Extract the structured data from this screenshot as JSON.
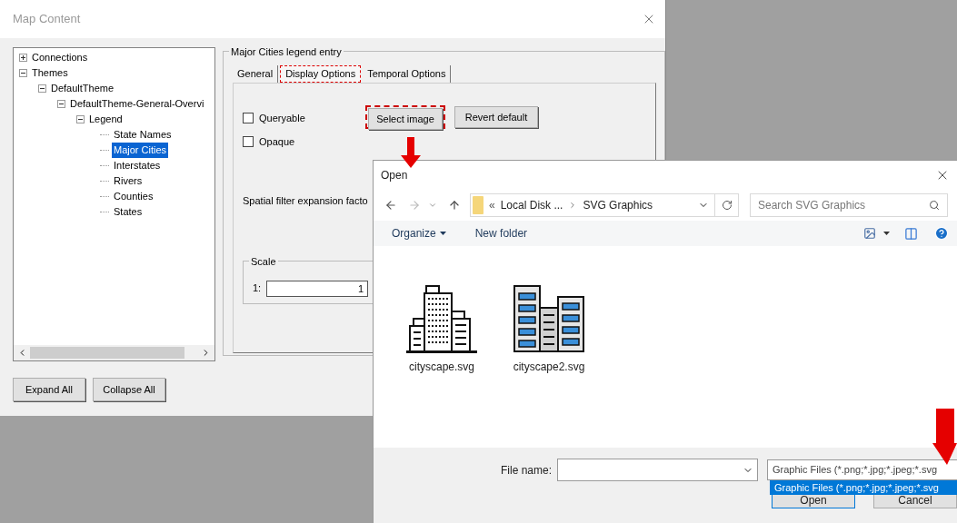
{
  "window": {
    "title": "Map Content"
  },
  "tree": [
    {
      "label": "Connections",
      "expanded": false,
      "selected": false
    },
    {
      "label": "Themes",
      "expanded": true,
      "selected": false,
      "children": [
        {
          "label": "DefaultTheme",
          "expanded": true,
          "selected": false,
          "children": [
            {
              "label": "DefaultTheme-General-Overvi",
              "expanded": true,
              "selected": false,
              "children": [
                {
                  "label": "Legend",
                  "expanded": true,
                  "selected": false,
                  "children": [
                    {
                      "label": "State Names",
                      "selected": false
                    },
                    {
                      "label": "Major Cities",
                      "selected": true
                    },
                    {
                      "label": "Interstates",
                      "selected": false
                    },
                    {
                      "label": "Rivers",
                      "selected": false
                    },
                    {
                      "label": "Counties",
                      "selected": false
                    },
                    {
                      "label": "States",
                      "selected": false
                    }
                  ]
                }
              ]
            }
          ]
        }
      ]
    }
  ],
  "tree_buttons": [
    "Expand All",
    "Collapse All"
  ],
  "entry": {
    "title": "Major Cities legend entry",
    "tabs": [
      {
        "label": "General",
        "selected": false
      },
      {
        "label": "Display Options",
        "selected": true
      },
      {
        "label": "Temporal Options",
        "selected": false
      }
    ],
    "checkboxes": [
      {
        "label": "Queryable",
        "checked": false
      },
      {
        "label": "Opaque",
        "checked": false
      }
    ],
    "buttons": [
      "Select image",
      "Revert default"
    ],
    "spatial_label": "Spatial filter expansion facto",
    "scale": {
      "title": "Scale",
      "prefix": "1:",
      "value": "1"
    }
  },
  "open_dialog": {
    "title": "Open",
    "path": {
      "overflow": "«",
      "segments": [
        "Local Disk ...",
        "SVG Graphics"
      ]
    },
    "search": {
      "placeholder": "Search SVG Graphics"
    },
    "toolbar": [
      "Organize",
      "New folder"
    ],
    "files": [
      {
        "name": "cityscape.svg",
        "kind": "outline"
      },
      {
        "name": "cityscape2.svg",
        "kind": "colored"
      }
    ],
    "file_name": {
      "label": "File name:"
    },
    "file_type": {
      "value": "Graphic Files (*.png;*.jpg;*.jpeg;*.svg",
      "options": [
        {
          "label": "Graphic Files (*.png;*.jpg;*.jpeg;*.svg",
          "selected": true
        }
      ]
    },
    "buttons": [
      "Open",
      "Cancel"
    ]
  }
}
